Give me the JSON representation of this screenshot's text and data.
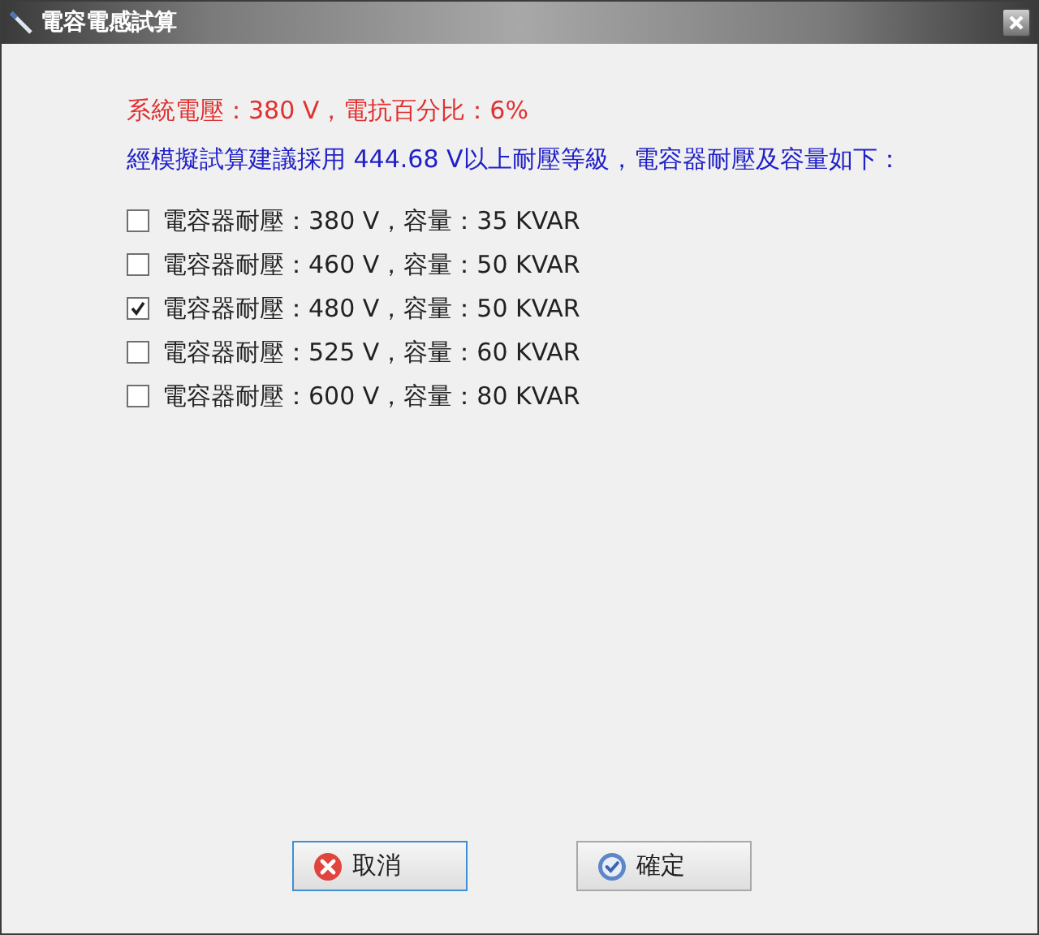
{
  "window": {
    "title": "電容電感試算"
  },
  "summary": "系統電壓：380 V，電抗百分比：6%",
  "recommendation": "經模擬試算建議採用 444.68 V以上耐壓等級，電容器耐壓及容量如下：",
  "options": [
    {
      "label": "電容器耐壓：380 V，容量：35 KVAR",
      "checked": false
    },
    {
      "label": "電容器耐壓：460 V，容量：50 KVAR",
      "checked": false
    },
    {
      "label": "電容器耐壓：480 V，容量：50 KVAR",
      "checked": true
    },
    {
      "label": "電容器耐壓：525 V，容量：60 KVAR",
      "checked": false
    },
    {
      "label": "電容器耐壓：600 V，容量：80 KVAR",
      "checked": false
    }
  ],
  "buttons": [
    {
      "kind": "cancel",
      "label": "取消",
      "focused": true
    },
    {
      "kind": "ok",
      "label": "確定",
      "focused": false
    }
  ]
}
